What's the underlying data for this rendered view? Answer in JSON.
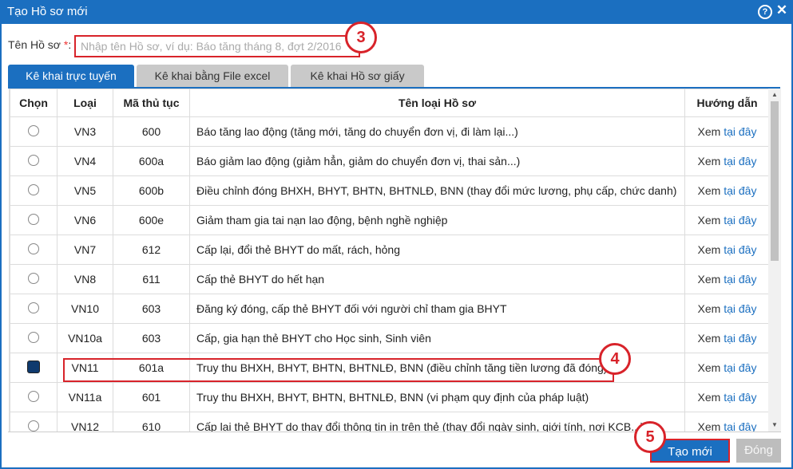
{
  "window": {
    "title": "Tạo Hồ sơ mới",
    "help_icon": "?",
    "close_icon": "✕"
  },
  "form": {
    "name_label": "Tên Hồ sơ",
    "required_mark": "*",
    "colon": ":",
    "name_placeholder": "Nhập tên Hồ sơ, ví dụ: Báo tăng tháng 8, đợt 2/2016",
    "name_value": ""
  },
  "tabs": [
    {
      "label": "Kê khai trực tuyến",
      "active": true
    },
    {
      "label": "Kê khai bằng File excel",
      "active": false
    },
    {
      "label": "Kê khai Hồ sơ giấy",
      "active": false
    }
  ],
  "table": {
    "headers": {
      "select": "Chọn",
      "type": "Loại",
      "code": "Mã thủ tục",
      "name": "Tên loại Hồ sơ",
      "guide": "Hướng dẫn"
    },
    "guide_prefix": "Xem",
    "guide_link": "tại đây",
    "rows": [
      {
        "type": "VN3",
        "code": "600",
        "name": "Báo tăng lao động (tăng mới, tăng do chuyển đơn vị, đi làm lại...)",
        "checked": false
      },
      {
        "type": "VN4",
        "code": "600a",
        "name": "Báo giảm lao động (giảm hẳn, giảm do chuyển đơn vị, thai sản...)",
        "checked": false
      },
      {
        "type": "VN5",
        "code": "600b",
        "name": "Điều chỉnh đóng BHXH, BHYT, BHTN, BHTNLĐ, BNN (thay đổi mức lương, phụ cấp, chức danh)",
        "checked": false
      },
      {
        "type": "VN6",
        "code": "600e",
        "name": "Giảm tham gia tai nạn lao động, bệnh nghề nghiệp",
        "checked": false
      },
      {
        "type": "VN7",
        "code": "612",
        "name": "Cấp lại, đổi thẻ BHYT do mất, rách, hỏng",
        "checked": false
      },
      {
        "type": "VN8",
        "code": "611",
        "name": "Cấp thẻ BHYT do hết hạn",
        "checked": false
      },
      {
        "type": "VN10",
        "code": "603",
        "name": "Đăng ký đóng, cấp thẻ BHYT đối với người chỉ tham gia BHYT",
        "checked": false
      },
      {
        "type": "VN10a",
        "code": "603",
        "name": "Cấp, gia hạn thẻ BHYT cho Học sinh, Sinh viên",
        "checked": false
      },
      {
        "type": "VN11",
        "code": "601a",
        "name": "Truy thu BHXH, BHYT, BHTN, BHTNLĐ, BNN (điều chỉnh tăng tiền lương đã đóng)",
        "checked": true
      },
      {
        "type": "VN11a",
        "code": "601",
        "name": "Truy thu BHXH, BHYT, BHTN, BHTNLĐ, BNN (vi phạm quy định của pháp luật)",
        "checked": false
      },
      {
        "type": "VN12",
        "code": "610",
        "name": "Cấp lại thẻ BHYT do thay đổi thông tin in trên thẻ (thay đổi ngày sinh, giới tính, nơi KCB...)",
        "checked": false
      }
    ]
  },
  "buttons": {
    "create": "Tạo mới",
    "close": "Đóng"
  },
  "annotations": {
    "step3": "3",
    "step4": "4",
    "step5": "5"
  },
  "colors": {
    "primary": "#1b6fc0",
    "highlight": "#d8232a",
    "disabled": "#bdbdbd"
  }
}
